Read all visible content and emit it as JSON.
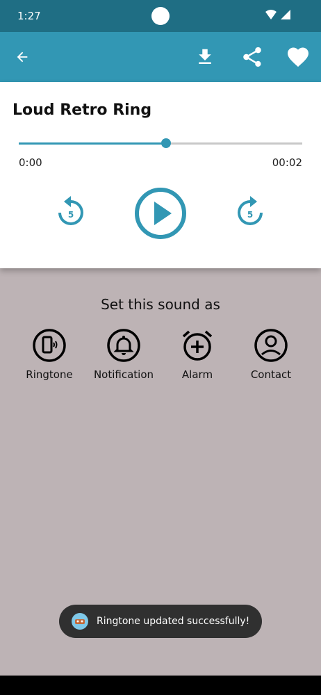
{
  "status_bar": {
    "time": "1:27"
  },
  "player": {
    "title": "Loud Retro Ring",
    "progress": 0.52,
    "time_start": "0:00",
    "time_end": "00:02",
    "rewind_seconds": "5",
    "forward_seconds": "5"
  },
  "set_as": {
    "title": "Set this sound as",
    "options": [
      {
        "label": "Ringtone",
        "icon": "phone-ring-icon"
      },
      {
        "label": "Notification",
        "icon": "bell-icon"
      },
      {
        "label": "Alarm",
        "icon": "alarm-add-icon"
      },
      {
        "label": "Contact",
        "icon": "contact-icon"
      }
    ]
  },
  "toast": {
    "message": "Ringtone updated successfully!"
  },
  "colors": {
    "accent": "#3297b4",
    "status_bar": "#1f6e84",
    "background": "#bdb3b5"
  }
}
